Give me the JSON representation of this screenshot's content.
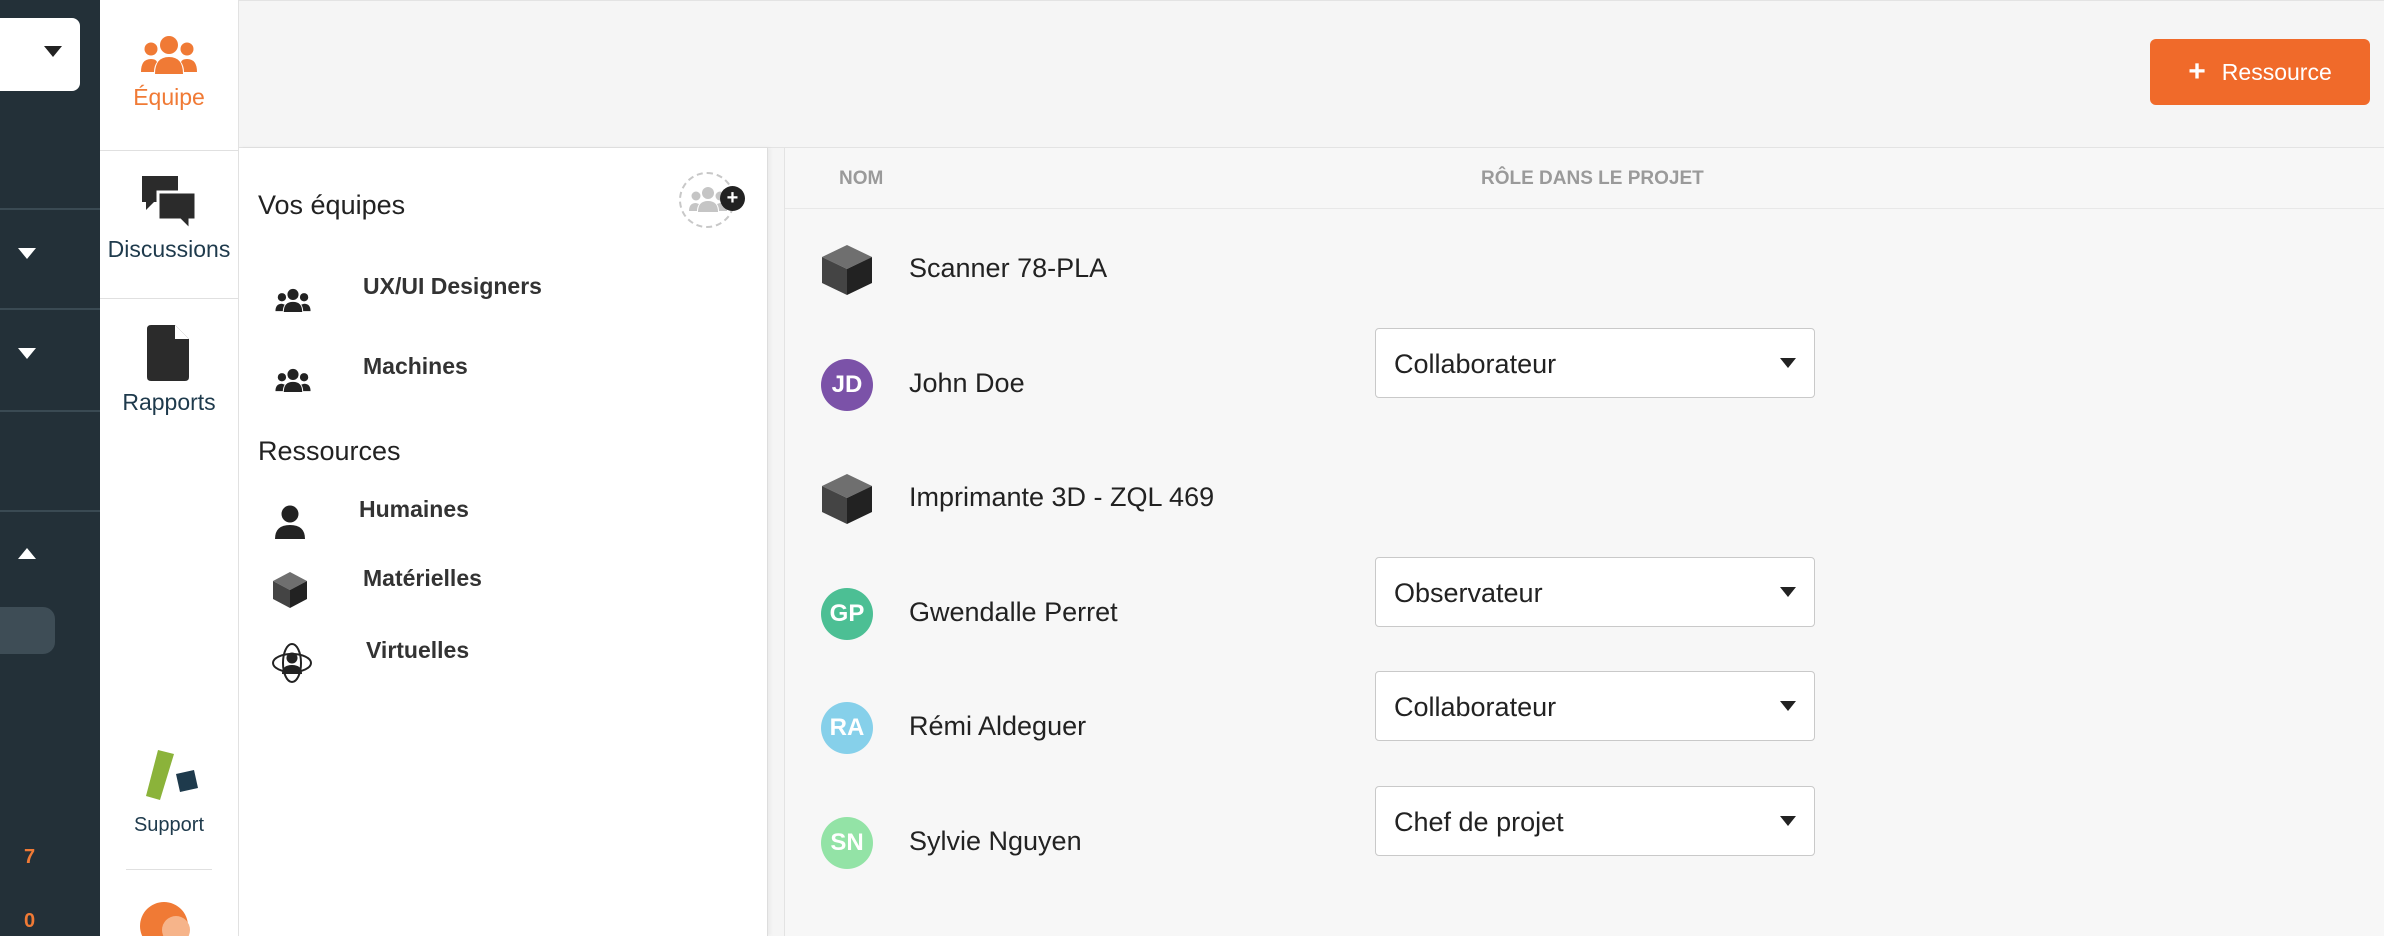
{
  "rail": {
    "counts": [
      "7",
      "0"
    ]
  },
  "nav": {
    "items": [
      {
        "label": "Équipe",
        "icon": "team-icon",
        "active": true
      },
      {
        "label": "Discussions",
        "icon": "chat-bubbles-icon"
      },
      {
        "label": "Rapports",
        "icon": "document-icon"
      }
    ],
    "support_label": "Support"
  },
  "header": {
    "add_button_label": "Ressource"
  },
  "teams_panel": {
    "title": "Vos équipes",
    "teams": [
      {
        "label": "UX/UI Designers",
        "icon": "group-icon"
      },
      {
        "label": "Machines",
        "icon": "group-icon"
      }
    ],
    "resources_title": "Ressources",
    "resources": [
      {
        "label": "Humaines",
        "icon": "person-icon"
      },
      {
        "label": "Matérielles",
        "icon": "cube-icon"
      },
      {
        "label": "Virtuelles",
        "icon": "virtual-person-icon"
      }
    ]
  },
  "table": {
    "columns": [
      "NOM",
      "RÔLE DANS LE PROJET"
    ],
    "rows": [
      {
        "name": "Scanner 78-PLA",
        "type": "material"
      },
      {
        "name": "John Doe",
        "initials": "JD",
        "color": "#7b52a8",
        "role": "Collaborateur"
      },
      {
        "name": "Imprimante 3D - ZQL 469",
        "type": "material"
      },
      {
        "name": "Gwendalle Perret",
        "initials": "GP",
        "color": "#4cbf94",
        "role": "Observateur"
      },
      {
        "name": "Rémi Aldeguer",
        "initials": "RA",
        "color": "#86d0ea",
        "role": "Collaborateur"
      },
      {
        "name": "Sylvie Nguyen",
        "initials": "SN",
        "color": "#93e3a6",
        "role": "Chef de projet"
      }
    ]
  },
  "colors": {
    "accent": "#f06a2a",
    "nav_text": "#1e3a4c",
    "rail": "#233038"
  }
}
